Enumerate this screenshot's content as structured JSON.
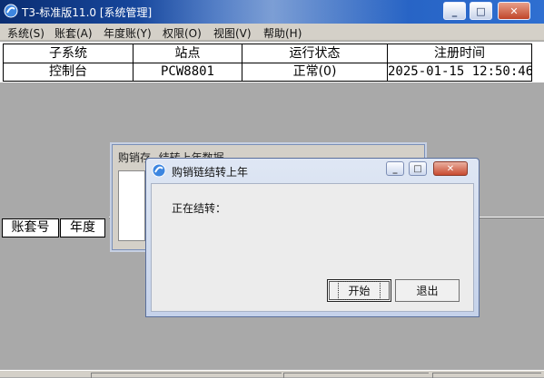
{
  "window": {
    "title": "T3-标准版11.0 [系统管理]"
  },
  "menu": [
    "系统(S)",
    "账套(A)",
    "年度账(Y)",
    "权限(O)",
    "视图(V)",
    "帮助(H)"
  ],
  "top_table": {
    "columns": [
      "子系统",
      "站点",
      "运行状态",
      "注册时间"
    ],
    "rows": [
      [
        "控制台",
        "PCW8801",
        "正常(0)",
        "2025-01-15 12:50:46"
      ]
    ]
  },
  "bottom_table": {
    "columns": [
      "账套号",
      "年度"
    ]
  },
  "back_dialog": {
    "title": "购销存--结转上年数据"
  },
  "dialog": {
    "title": "购销链结转上年",
    "status_label": "正在结转：",
    "start_button": "开始",
    "exit_button": "退出"
  }
}
